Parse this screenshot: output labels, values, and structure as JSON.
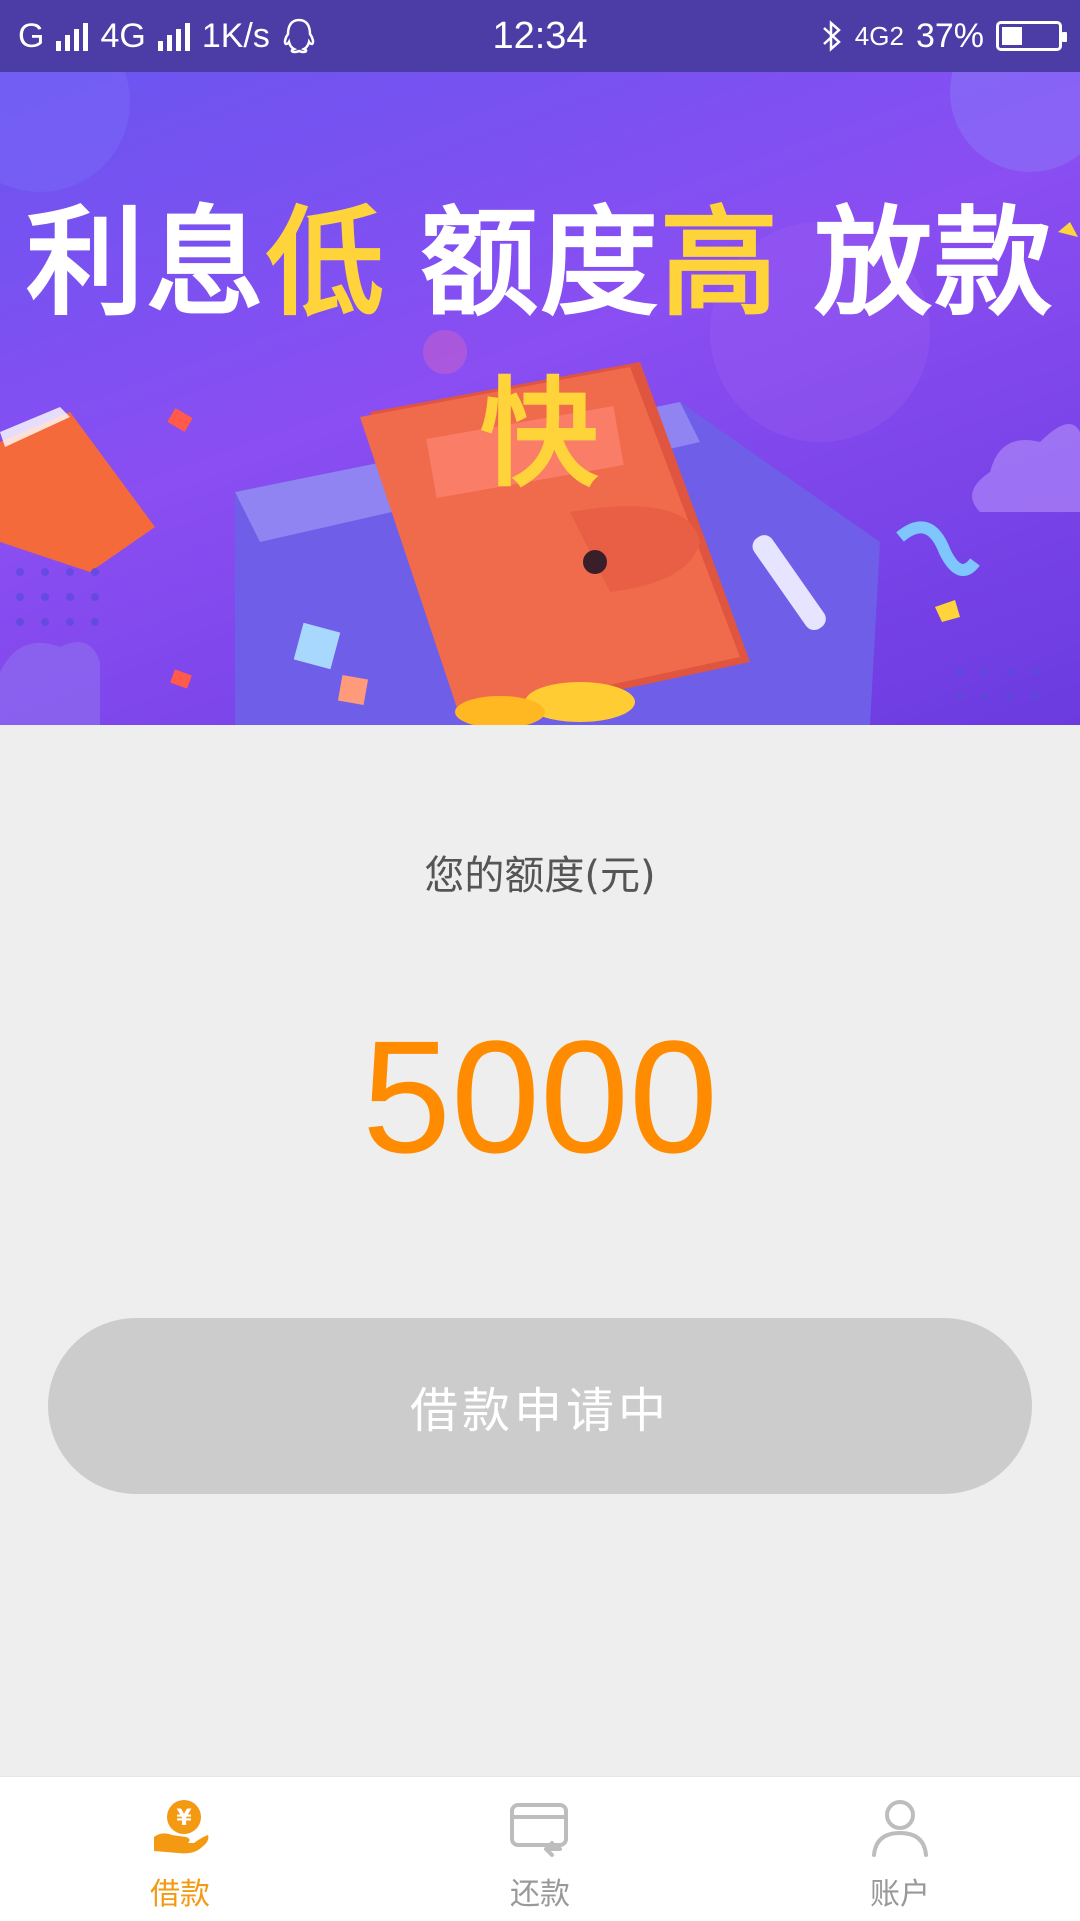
{
  "status_bar": {
    "carrier1": "G",
    "carrier2": "4G",
    "speed": "1K/s",
    "time": "12:34",
    "network_right": "4G2",
    "battery_percent": "37%",
    "battery_level": 0.37
  },
  "banner": {
    "headline": {
      "part1_white": "利息",
      "part1_yellow": "低",
      "part2_white": "额度",
      "part2_yellow": "高",
      "part3_white": "放款",
      "part3_yellow": "快"
    },
    "colors": {
      "white": "#ffffff",
      "yellow": "#ffd33a"
    }
  },
  "quota": {
    "label": "您的额度(元)",
    "value": "5000",
    "color": "#ff8c00"
  },
  "apply_button": {
    "label": "借款申请中",
    "background": "#cccccc"
  },
  "tabbar": {
    "active_color": "#f39a12",
    "inactive_color": "#999999",
    "items": [
      {
        "label": "借款",
        "icon": "loan-hand-yen-icon",
        "active": true
      },
      {
        "label": "还款",
        "icon": "repay-card-icon",
        "active": false
      },
      {
        "label": "账户",
        "icon": "account-person-icon",
        "active": false
      }
    ]
  }
}
